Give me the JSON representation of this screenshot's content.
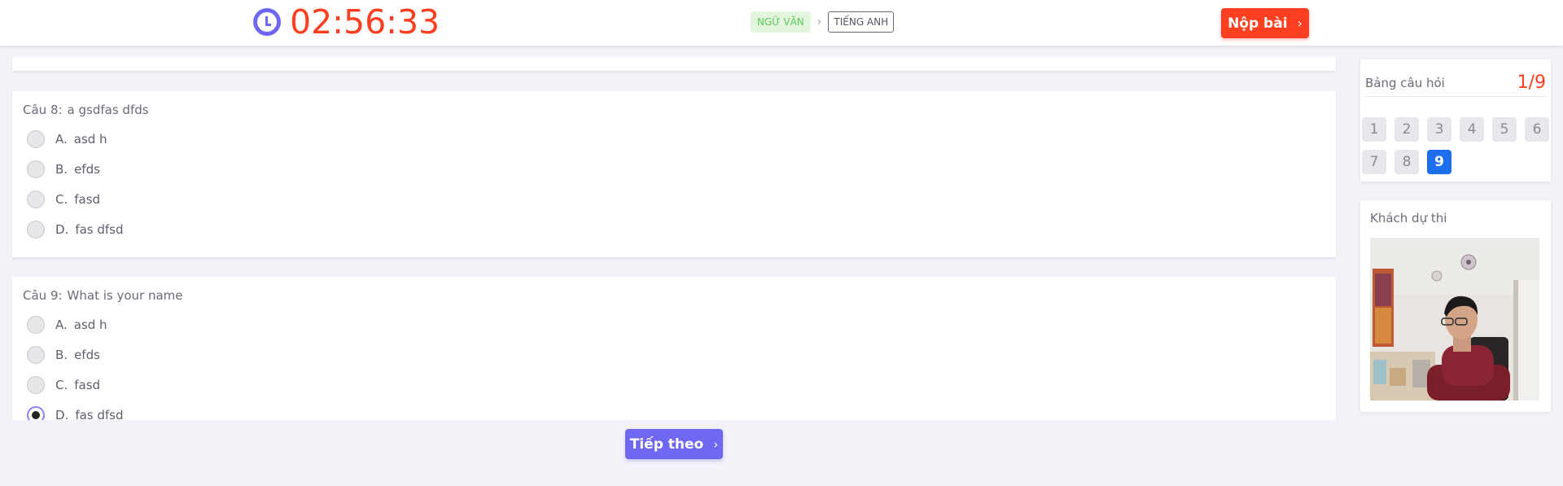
{
  "header": {
    "timer": "02:56:33",
    "subjects": {
      "current": "NGỮ VĂN",
      "separator": "›",
      "next": "TIẾNG ANH"
    },
    "submit_label": "Nộp bài",
    "submit_chevron": "›"
  },
  "questions": [
    {
      "number": "Câu 8:",
      "text": "a gsdfas dfds",
      "options": [
        {
          "letter": "A.",
          "text": "asd h",
          "selected": false
        },
        {
          "letter": "B.",
          "text": "efds",
          "selected": false
        },
        {
          "letter": "C.",
          "text": "fasd",
          "selected": false
        },
        {
          "letter": "D.",
          "text": "fas dfsd",
          "selected": false
        }
      ]
    },
    {
      "number": "Câu 9:",
      "text": "What is your name",
      "options": [
        {
          "letter": "A.",
          "text": "asd h",
          "selected": false
        },
        {
          "letter": "B.",
          "text": "efds",
          "selected": false
        },
        {
          "letter": "C.",
          "text": "fasd",
          "selected": false
        },
        {
          "letter": "D.",
          "text": "fas dfsd",
          "selected": true
        }
      ]
    }
  ],
  "next_button": {
    "label": "Tiếp theo",
    "chevron": "›"
  },
  "question_board": {
    "label": "Bảng câu hỏi",
    "count": "1/9",
    "numbers": [
      "1",
      "2",
      "3",
      "4",
      "5",
      "6",
      "7",
      "8",
      "9"
    ],
    "active": "9"
  },
  "candidate": {
    "label": "Khách dự thi"
  },
  "colors": {
    "accent": "#6f67f2",
    "danger": "#ff3f1f",
    "active_number": "#1e6ef0",
    "subject_active_bg": "#e3f6dd",
    "subject_active_text": "#5dc85a"
  },
  "icons": {
    "timer": "clock-icon",
    "submit": "chevron-right-icon",
    "next": "chevron-right-icon"
  }
}
